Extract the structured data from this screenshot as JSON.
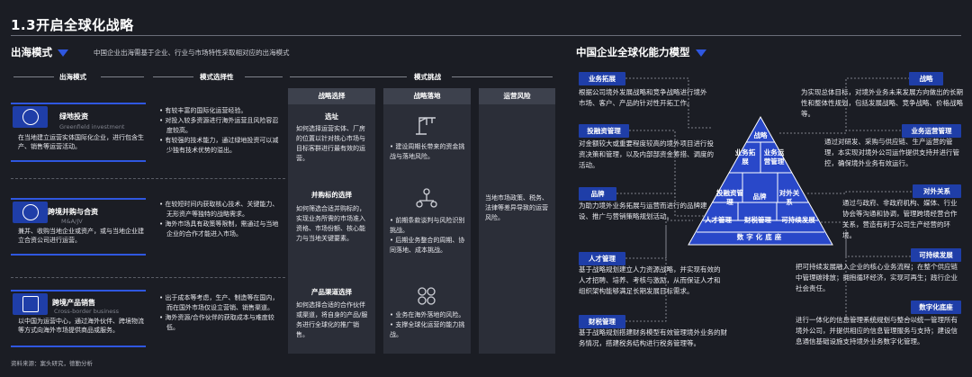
{
  "page_title": "1.3开启全球化战略",
  "left": {
    "title": "出海模式",
    "subtitle": "中国企业出海需基于企业、行业与市场特性采取相对应的出海模式",
    "headers": {
      "mode": "出海模式",
      "selectivity": "模式选择性",
      "challenge": "模式挑战"
    },
    "challenge_tabs": [
      "战略选择",
      "战略落地",
      "运营风险"
    ],
    "modes": [
      {
        "name": "绿地投资",
        "name_en": "Greenfield investment",
        "desc": "在当地建立运营实体国际化企业，进行包含生产、销售等运营活动。",
        "selectivity": [
          "• 有较丰富的国际化运营经验。",
          "• 对投入较多资源进行海外运营且风险容忍度较高。",
          "• 有较强的技术能力，通过绿地投资可以减少独有技术优势的溢出。"
        ],
        "strategy_head": "选址",
        "strategy_text": "如何选择运营实体、厂房的位置以针对核心市场与目标客群进行最有效的运营。",
        "landing_text": "• 建设周期长带来的资金挑战与落地风险。"
      },
      {
        "name": "跨境并购与合资",
        "name_en": "M&A/JV",
        "desc": "兼并、收购当地企业或资产，或与当地企业建立合资公司进行运营。",
        "selectivity": [
          "• 在较短时间内获取核心技术、关键能力、无形资产等独特的战略需求。",
          "• 海外市场具有政策等限制，需通过与当地企业的合作才能进入市场。"
        ],
        "strategy_head": "并购标的选择",
        "strategy_text": "如何筛选合适并购标的，实现业务所需的市场准入资格、市场份额、核心能力与当地关键要素。",
        "landing_text": "• 前期条款谈判与风险识别挑战。\n• 后期业务整合的周期、协同落地、成本挑战。"
      },
      {
        "name": "跨境产品销售",
        "name_en": "Cross-border business",
        "desc": "以中国为运营中心，通过海外伙伴、跨境物流等方式向海外市场提供商品或服务。",
        "selectivity": [
          "• 出于成本等考虑，生产、制造等在国内，而在国外市场仅设立营销、销售渠道。",
          "• 海外资源/合作伙伴的获取成本与难度较低。"
        ],
        "strategy_head": "产品渠道选择",
        "strategy_text": "如何选择合适的合作伙伴或渠道，将自身的产品/服务进行全球化的推广销售。",
        "landing_text": "• 业务在海外落地的风险。\n• 支撑全球化运营的能力挑战。"
      }
    ],
    "ops_risk_text": "当地市场政策、税务、法律等差异导致的运营风险。",
    "source": "资料来源：案头研究，德勤分析"
  },
  "right": {
    "title": "中国企业全球化能力模型",
    "pyramid": {
      "top": "战略",
      "row2": [
        "业务拓展",
        "业务运营管理"
      ],
      "row3": [
        "投融资管理",
        "品牌",
        "对外关系"
      ],
      "row4": [
        "人才管理",
        "财税管理",
        "可持续发展"
      ],
      "base": "数字化底座"
    },
    "left_caps": [
      {
        "label": "业务拓展",
        "desc": "根据公司境外发展战略和竞争战略进行境外市场、客户、产品的针对性开拓工作。"
      },
      {
        "label": "投融资管理",
        "desc": "对金额较大或重要程度较高的境外项目进行投资决策和管理，以及内部部资金筹措、调度的活动。"
      },
      {
        "label": "品牌",
        "desc": "为助力境外业务拓展与运营而进行的品牌建设、推广与营销策略规划活动。"
      },
      {
        "label": "人才管理",
        "desc": "基于战略规划建立人力资源战略，并实现有效的人才招聘、培养、考核与激励，从而保证人才和组织架构能够满足长期发展目标需求。"
      },
      {
        "label": "财税管理",
        "desc": "基于战略规划搭建财务模型有效管理境外业务的财务情况，搭建税务结构进行税务管理等。"
      }
    ],
    "right_caps": [
      {
        "label": "战略",
        "desc": "为实现总体目标，对境外业务未来发展方向做出的长期性和整体性规划，包括发展战略、竞争战略、价格战略等。"
      },
      {
        "label": "业务运营管理",
        "desc": "通过对研发、采购与供应链、生产运营的管理，本实现对境外公司运作提供支持并进行管控，确保境外业务有效运行。"
      },
      {
        "label": "对外关系",
        "desc": "通过与政府、非政府机构、媒体、行业协会等沟通和协调，管理跨境经营合作关系，营造有利于公司生产经营的环境。"
      },
      {
        "label": "可持续发展",
        "desc": "把可持续发展融入企业的核心业务流程；在整个供应链中管理碳排放；拥抱循环经济，实现可再生；践行企业社会责任。"
      },
      {
        "label": "数字化底座",
        "desc": "进行一体化的信息管理系统规划与整合以统一管理所有境外公司，并提供相应的信息管理服务与支持；建设信息通信基础设施支持境外业务数字化管理。"
      }
    ]
  }
}
